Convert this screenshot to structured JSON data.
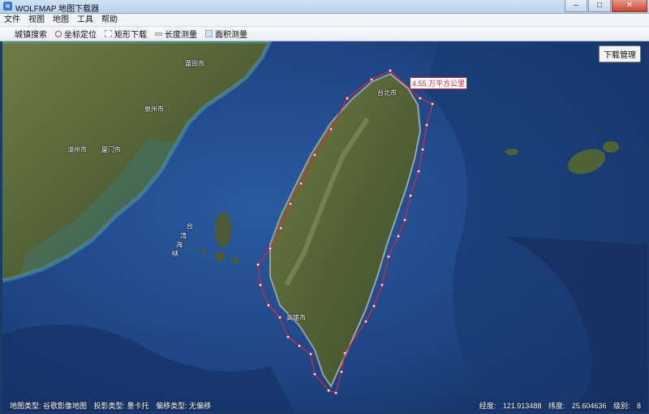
{
  "window": {
    "title": "WOLFMAP 地图下载器",
    "icon": "wolf-app-icon"
  },
  "menu": [
    "文件",
    "视图",
    "地图",
    "工具",
    "帮助"
  ],
  "toolbar": [
    {
      "label": "城镇搜索",
      "icon": "none"
    },
    {
      "label": "坐标定位",
      "icon": "pin-icon"
    },
    {
      "label": "矩形下载",
      "icon": "rect-icon"
    },
    {
      "label": "长度测量",
      "icon": "ruler-icon"
    },
    {
      "label": "面积测量",
      "icon": "area-icon"
    }
  ],
  "map": {
    "download_manager": "下载管理",
    "area_label": "4.55 万平方公里",
    "places": [
      {
        "name": "莆田市"
      },
      {
        "name": "泉州市"
      },
      {
        "name": "漳州市"
      },
      {
        "name": "厦门市"
      },
      {
        "name": "高雄市"
      },
      {
        "name": "台北市"
      },
      {
        "name": "台"
      },
      {
        "name": "湾"
      },
      {
        "name": "海"
      },
      {
        "name": "峡"
      }
    ]
  },
  "status": {
    "map_type": "地图类型: 谷歌影像地图",
    "projection": "投影类型: 墨卡托",
    "offset": "偏移类型: 无偏移",
    "lon_label": "经度:",
    "lon": "121.913488",
    "lat_label": "纬度:",
    "lat": "25.604636",
    "level_label": "级别:",
    "level": "8"
  },
  "colors": {
    "polygon": "#e0243c",
    "sea": "#1d3f7a",
    "land": "#5d6e3c"
  }
}
